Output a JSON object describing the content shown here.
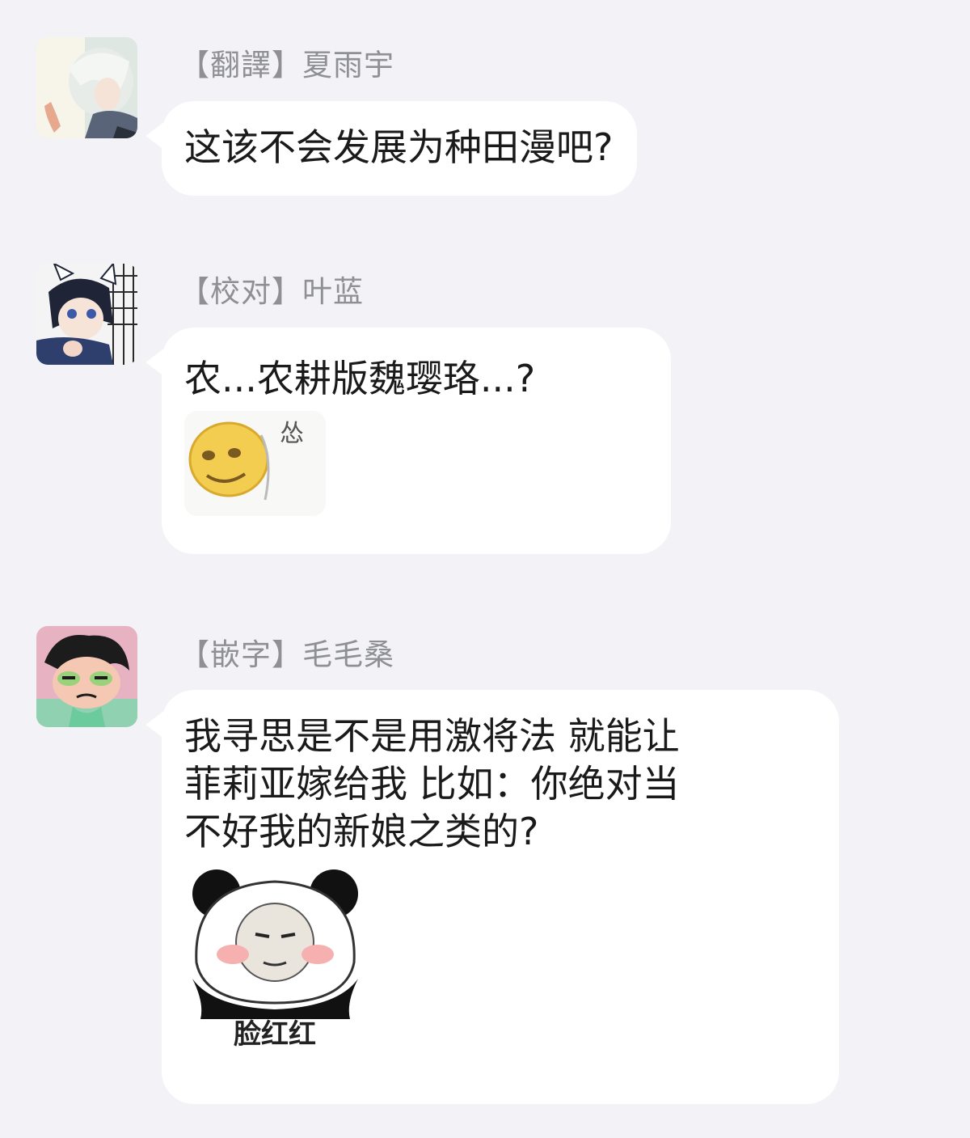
{
  "messages": [
    {
      "sender": "【翻譯】夏雨宇",
      "avatar_icon": "white-haired-anime-avatar-icon",
      "lines": [
        "这该不会发展为种田漫吧?"
      ]
    },
    {
      "sender": "【校对】叶蓝",
      "avatar_icon": "cat-ear-boy-avatar-icon",
      "lines": [
        "农...农耕版魏璎珞...?"
      ],
      "sticker": {
        "icon": "timid-smiley-sticker-icon",
        "caption": "怂"
      }
    },
    {
      "sender": "【嵌字】毛毛桑",
      "avatar_icon": "grumpy-girl-avatar-icon",
      "lines": [
        "我寻思是不是用激将法 就能让",
        "菲莉亚嫁给我 比如：你绝对当",
        "不好我的新娘之类的?"
      ],
      "sticker": {
        "icon": "panda-blushing-meme-icon",
        "caption": "脸红红"
      }
    }
  ],
  "colors": {
    "background": "#f2f2f7",
    "bubble": "#ffffff",
    "sender_text": "#8f8f96",
    "message_text": "#1a1a1a"
  }
}
